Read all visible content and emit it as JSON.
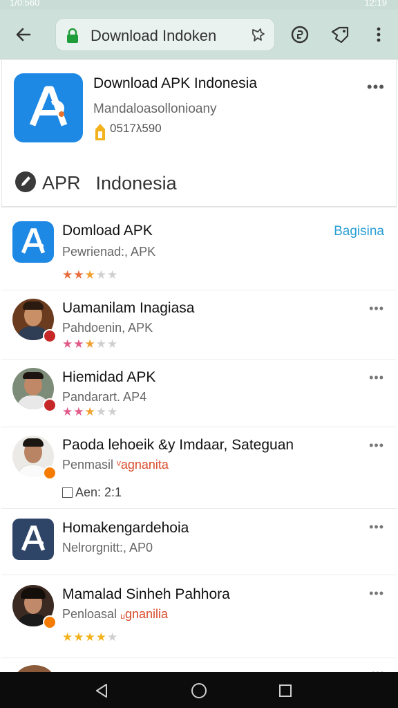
{
  "status_bar": {
    "left": "1/0:560",
    "right": "12:19"
  },
  "toolbar": {
    "url_text": "Download Indoken"
  },
  "featured": {
    "title": "Download APK Indonesia",
    "developer": "Mandaloasollonioany",
    "code": "0517λ590",
    "section_word1": "APR",
    "section_word2": "Indonesia"
  },
  "list": [
    {
      "name": "Domload APK",
      "sub": "Pewrienad:, APK",
      "action": "Bagisina",
      "rating": 2.5,
      "star_color": "#e86a3a"
    },
    {
      "name": "Uamanilam Inagiasa",
      "sub": "Pahdoenin, APK",
      "rating": 2.5,
      "star_color": "#e05a8a"
    },
    {
      "name": "Hiemidad APK",
      "sub": "Pandarart. AP4",
      "rating": 2.5,
      "star_color": "#e05a8a"
    },
    {
      "name": "Paoda lehoeik &y Imdaar, Sateguan",
      "sub_prefix": "Penmasil",
      "sub_highlight": "ᵛagnanita",
      "meta": "Aen: 2:1"
    },
    {
      "name": "Homakengardehoia",
      "sub": "Nelrorgnitt:, AP0"
    },
    {
      "name": "Mamalad Sinheh Pahhora",
      "sub_prefix": "Penloasal",
      "sub_highlight": "ᵤgnanilia",
      "rating": 4,
      "star_color": "#f2b21b"
    }
  ],
  "colors": {
    "accent_blue": "#1e88e5",
    "toolbar": "#cde0da",
    "link": "#2a9fd6",
    "badge_red": "#c62828",
    "badge_orange": "#f57c00"
  }
}
